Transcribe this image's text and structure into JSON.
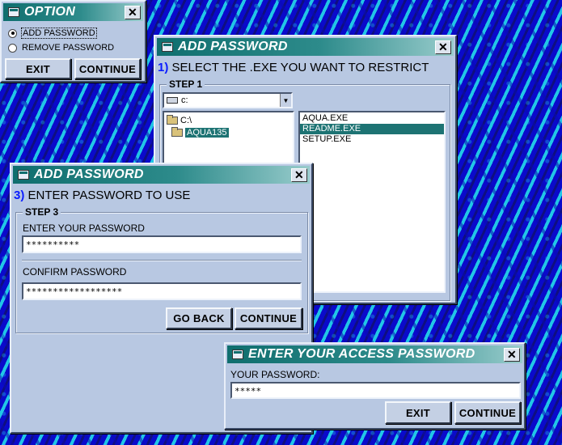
{
  "option_window": {
    "title": "OPTION",
    "options": [
      "ADD PASSWORD",
      "REMOVE PASSWORD"
    ],
    "selected_index": 0,
    "exit_label": "EXIT",
    "continue_label": "CONTINUE"
  },
  "select_exe_window": {
    "title": "ADD PASSWORD",
    "step_number": "1)",
    "heading": "SELECT THE .EXE YOU WANT TO RESTRICT",
    "group_label": "STEP 1",
    "drive": "c:",
    "directories": [
      {
        "name": "C:\\",
        "selected": false
      },
      {
        "name": "AQUA135",
        "selected": true
      }
    ],
    "files": [
      {
        "name": "AQUA.EXE",
        "selected": false
      },
      {
        "name": "README.EXE",
        "selected": true
      },
      {
        "name": "SETUP.EXE",
        "selected": false
      }
    ]
  },
  "enter_password_window": {
    "title": "ADD PASSWORD",
    "step_number": "3)",
    "heading": "ENTER PASSWORD TO USE",
    "group_label": "STEP 3",
    "password_label": "ENTER YOUR PASSWORD",
    "password_value": "**********",
    "confirm_label": "CONFIRM PASSWORD",
    "confirm_value": "******************",
    "go_back_label": "GO BACK",
    "continue_label": "CONTINUE"
  },
  "access_password_window": {
    "title": "ENTER YOUR ACCESS PASSWORD",
    "password_label": "YOUR PASSWORD:",
    "password_value": "*****",
    "exit_label": "EXIT",
    "continue_label": "CONTINUE"
  },
  "icons": [
    "window-icon",
    "close-icon",
    "folder-icon",
    "drive-icon",
    "dropdown-arrow-icon"
  ],
  "colors": {
    "titlebar": "#0f6e6e",
    "window_bg": "#b8c8e2",
    "selection": "#1d7373",
    "step_number": "#0a1cff",
    "desktop_primary": "#0a0acb",
    "desktop_secondary": "#21c6e6"
  }
}
